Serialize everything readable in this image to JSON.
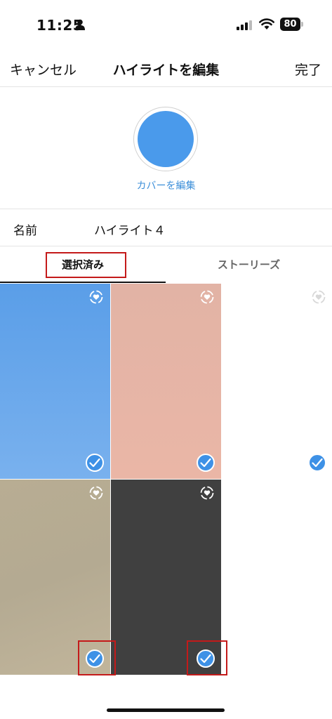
{
  "status_bar": {
    "time": "11:25",
    "battery": "80",
    "icons": [
      "person-icon",
      "signal-icon",
      "wifi-icon",
      "battery-icon"
    ]
  },
  "nav": {
    "cancel": "キャンセル",
    "title": "ハイライトを編集",
    "done": "完了"
  },
  "cover": {
    "color": "#4a9aeb",
    "edit_label": "カバーを編集"
  },
  "name_row": {
    "label": "名前",
    "value": "ハイライト４"
  },
  "tabs": [
    {
      "label": "選択済み",
      "active": true
    },
    {
      "label": "ストーリーズ",
      "active": false
    }
  ],
  "stories": [
    {
      "color": "#6aa7ea",
      "selected": true
    },
    {
      "color": "#e5b4a5",
      "selected": true
    },
    {
      "color": "#ffffff",
      "selected": true
    },
    {
      "color": "#b8ad93",
      "selected": true
    },
    {
      "color": "#404040",
      "selected": true
    }
  ],
  "colors": {
    "accent": "#3e91e6",
    "annotation": "#c41a1a"
  }
}
